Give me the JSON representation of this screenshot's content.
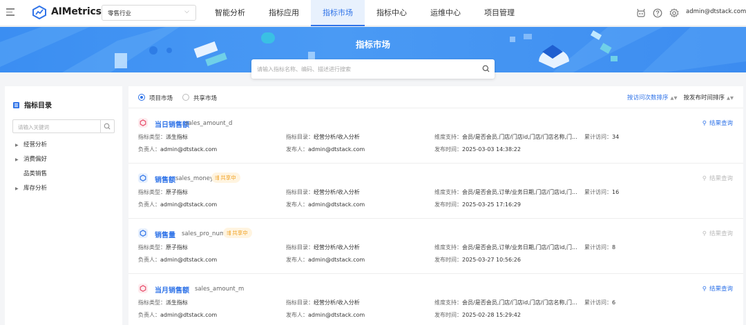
{
  "colors": {
    "primary": "#2f73e8",
    "shared_badge_bg": "#fff4e0",
    "shared_badge_text": "#f0a020",
    "derived_icon": "#e84d6a",
    "atomic_icon": "#2f73e8"
  },
  "nav": {
    "brand": "AIMetrics",
    "industry": "零售行业",
    "menu": [
      "智能分析",
      "指标应用",
      "指标市场",
      "指标中心",
      "运维中心",
      "项目管理"
    ],
    "active_index": 2,
    "user": "admin@dtstack.com",
    "icons": [
      "robot-icon",
      "help-icon",
      "settings-icon"
    ]
  },
  "banner": {
    "title": "指标市场",
    "search_placeholder": "请输入指标名称、编码、描述进行搜索"
  },
  "left": {
    "title": "指标目录",
    "search_placeholder": "请输入关键词",
    "tree": [
      {
        "label": "经营分析",
        "expandable": true
      },
      {
        "label": "消费偏好",
        "expandable": true
      },
      {
        "label": "品类销售",
        "expandable": false
      },
      {
        "label": "库存分析",
        "expandable": true
      }
    ]
  },
  "main": {
    "tabs": [
      {
        "label": "项目市场",
        "selected": true
      },
      {
        "label": "共享市场",
        "selected": false
      }
    ],
    "sort_visits": "按访问次数排序",
    "sort_time": "按发布时间排序",
    "query_label": "结果查询",
    "shared_label": "共享中",
    "cards": [
      {
        "name": "当日销售额",
        "code": "sales_amount_d",
        "shared": false,
        "kind": "derived",
        "query_enabled": true,
        "type_label": "指标类型：",
        "type": "派生指标",
        "catalog_label": "指标目录：",
        "catalog": "经营分析/收入分析",
        "dims_label": "维度支持：",
        "dims": "会员/是否会员,门店/门店id,门店/门店名称,门...",
        "visits_label": "累计访问：",
        "visits": "34",
        "owner_label": "负责人：",
        "owner": "admin@dtstack.com",
        "publisher_label": "发布人：",
        "publisher": "admin@dtstack.com",
        "time_label": "发布时间：",
        "time": "2025-03-03 14:38:22"
      },
      {
        "name": "销售额",
        "code": "sales_money",
        "shared": true,
        "kind": "atomic",
        "query_enabled": false,
        "type_label": "指标类型：",
        "type": "原子指标",
        "catalog_label": "指标目录：",
        "catalog": "经营分析/收入分析",
        "dims_label": "维度支持：",
        "dims": "会员/是否会员,订单/业务日期,门店/门店id,门...",
        "visits_label": "累计访问：",
        "visits": "16",
        "owner_label": "负责人：",
        "owner": "admin@dtstack.com",
        "publisher_label": "发布人：",
        "publisher": "admin@dtstack.com",
        "time_label": "发布时间：",
        "time": "2025-03-25 17:16:29"
      },
      {
        "name": "销售量",
        "code": "sales_pro_num",
        "shared": true,
        "kind": "atomic",
        "query_enabled": false,
        "type_label": "指标类型：",
        "type": "原子指标",
        "catalog_label": "指标目录：",
        "catalog": "经营分析/收入分析",
        "dims_label": "维度支持：",
        "dims": "会员/是否会员,订单/业务日期,门店/门店id,门...",
        "visits_label": "累计访问：",
        "visits": "8",
        "owner_label": "负责人：",
        "owner": "admin@dtstack.com",
        "publisher_label": "发布人：",
        "publisher": "admin@dtstack.com",
        "time_label": "发布时间：",
        "time": "2025-03-27 10:56:26"
      },
      {
        "name": "当月销售额",
        "code": "sales_amount_m",
        "shared": false,
        "kind": "derived",
        "query_enabled": true,
        "type_label": "指标类型：",
        "type": "派生指标",
        "catalog_label": "指标目录：",
        "catalog": "经营分析/收入分析",
        "dims_label": "维度支持：",
        "dims": "会员/是否会员,门店/门店id,门店/门店名称,门...",
        "visits_label": "累计访问：",
        "visits": "6",
        "owner_label": "负责人：",
        "owner": "admin@dtstack.com",
        "publisher_label": "发布人：",
        "publisher": "admin@dtstack.com",
        "time_label": "发布时间：",
        "time": "2025-02-28 15:29:42"
      }
    ]
  }
}
